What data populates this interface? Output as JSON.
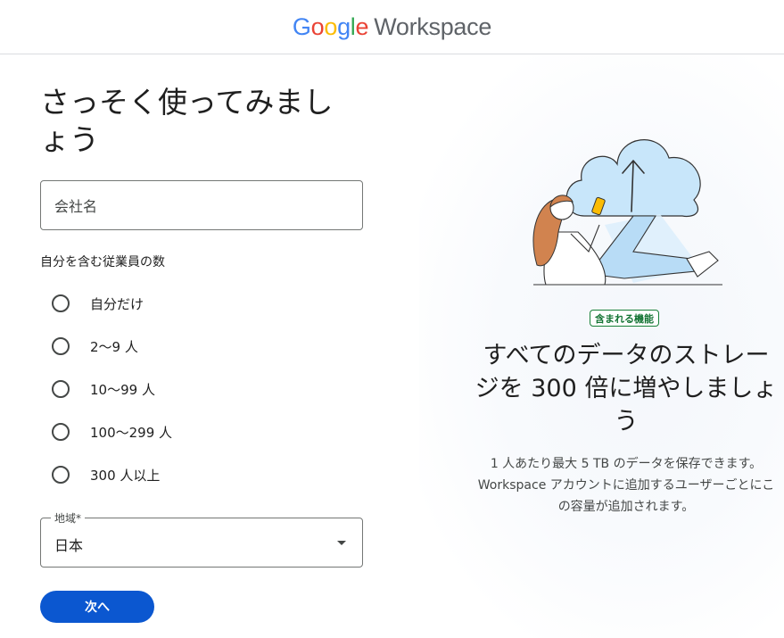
{
  "header": {
    "logo_letters": [
      "G",
      "o",
      "o",
      "g",
      "l",
      "e"
    ],
    "product_name": "Workspace"
  },
  "form": {
    "title": "さっそく使ってみましょう",
    "company_field": {
      "placeholder": "会社名",
      "value": ""
    },
    "employees_label": "自分を含む従業員の数",
    "employee_options": [
      {
        "label": "自分だけ",
        "selected": false
      },
      {
        "label": "2～9 人",
        "selected": false
      },
      {
        "label": "10～99 人",
        "selected": false
      },
      {
        "label": "100～299 人",
        "selected": false
      },
      {
        "label": "300 人以上",
        "selected": false
      }
    ],
    "region": {
      "label": "地域*",
      "value": "日本"
    },
    "next_button": "次へ"
  },
  "promo": {
    "badge": "含まれる機能",
    "title": "すべてのデータのストレージを 300 倍に増やしましょう",
    "description": "1 人あたり最大 5 TB のデータを保存できます。Workspace アカウントに追加するユーザーごとにこの容量が追加されます。"
  },
  "colors": {
    "google_blue": "#4285F4",
    "google_red": "#EA4335",
    "google_yellow": "#FBBC04",
    "google_green": "#34A853",
    "primary_button": "#0b57d0",
    "badge_green": "#137333"
  }
}
